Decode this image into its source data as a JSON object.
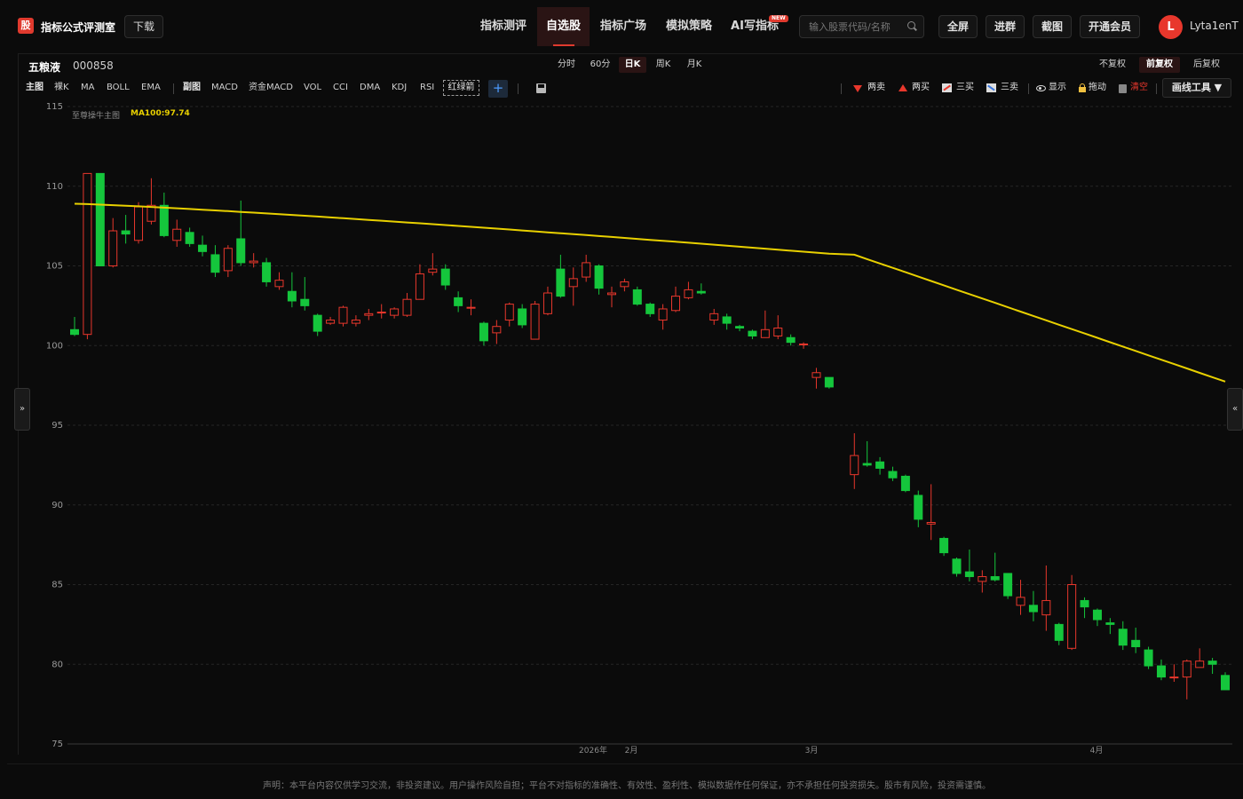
{
  "header": {
    "logo_text": "股",
    "brand": "指标公式评测室",
    "download": "下载",
    "nav": [
      {
        "label": "指标测评",
        "active": false
      },
      {
        "label": "自选股",
        "active": true
      },
      {
        "label": "指标广场",
        "active": false
      },
      {
        "label": "模拟策略",
        "active": false
      },
      {
        "label": "AI写指标",
        "active": false
      }
    ],
    "new_badge": "NEW",
    "search_placeholder": "输入股票代码/名称",
    "buttons": [
      "全屏",
      "进群",
      "截图",
      "开通会员"
    ],
    "avatar_letter": "L",
    "username": "Lyta1enT"
  },
  "stock": {
    "name": "五粮液",
    "code": "000858"
  },
  "periods": [
    {
      "label": "分时",
      "active": false
    },
    {
      "label": "60分",
      "active": false
    },
    {
      "label": "日K",
      "active": true
    },
    {
      "label": "周K",
      "active": false
    },
    {
      "label": "月K",
      "active": false
    }
  ],
  "adjustments": [
    {
      "label": "不复权",
      "active": false
    },
    {
      "label": "前复权",
      "active": true
    },
    {
      "label": "后复权",
      "active": false
    }
  ],
  "indicator_bar": {
    "main_label": "主图",
    "main_items": [
      "裸K",
      "MA",
      "BOLL",
      "EMA"
    ],
    "sub_label": "副图",
    "sub_items": [
      "MACD",
      "资金MACD",
      "VOL",
      "CCI",
      "DMA",
      "KDJ",
      "RSI"
    ],
    "red_green_arrow": "红绿箭",
    "add": "+"
  },
  "draw_bar": {
    "two_sell": "两卖",
    "two_buy": "两买",
    "three_buy": "三买",
    "three_sell": "三卖",
    "show": "显示",
    "drag": "拖动",
    "clear": "清空",
    "draw_tools": "画线工具 ▼"
  },
  "legend": {
    "main": "至尊操牛主图",
    "ma": "MA100:97.74"
  },
  "side": {
    "left": "»",
    "right": "«"
  },
  "colors": {
    "up": "#e8372c",
    "down": "#15c63c",
    "ma": "#e8d000",
    "accent": "#e03a2e"
  },
  "chart_data": {
    "type": "candlestick",
    "y_ticks": [
      115,
      110,
      105,
      100,
      95,
      90,
      85,
      80,
      75
    ],
    "ylim": [
      75,
      115
    ],
    "x_labels": [
      "2026年",
      "2月",
      "3月",
      "4月"
    ],
    "ma100_start": 108.9,
    "ma100_last": 97.74,
    "candles": [
      [
        101.0,
        100.7,
        101.8,
        100.6
      ],
      [
        100.7,
        110.8,
        110.8,
        100.4
      ],
      [
        110.8,
        105.0,
        110.8,
        105.0
      ],
      [
        105.0,
        107.2,
        108.0,
        104.9
      ],
      [
        107.2,
        107.0,
        108.2,
        106.4
      ],
      [
        106.6,
        108.7,
        109.0,
        106.4
      ],
      [
        107.8,
        108.8,
        110.5,
        107.6
      ],
      [
        108.8,
        106.9,
        109.6,
        106.8
      ],
      [
        106.6,
        107.3,
        107.9,
        106.2
      ],
      [
        107.1,
        106.4,
        107.4,
        106.2
      ],
      [
        106.3,
        105.9,
        106.9,
        105.6
      ],
      [
        105.7,
        104.6,
        106.3,
        104.3
      ],
      [
        104.7,
        106.1,
        106.3,
        104.3
      ],
      [
        106.7,
        105.2,
        109.1,
        105.0
      ],
      [
        105.2,
        105.3,
        105.8,
        104.9
      ],
      [
        105.2,
        104.0,
        105.5,
        103.7
      ],
      [
        103.7,
        104.1,
        104.6,
        103.5
      ],
      [
        103.4,
        102.8,
        104.6,
        102.4
      ],
      [
        102.9,
        102.5,
        104.3,
        102.2
      ],
      [
        101.9,
        100.9,
        102.0,
        100.6
      ],
      [
        101.4,
        101.6,
        101.8,
        101.3
      ],
      [
        101.4,
        102.4,
        102.5,
        101.2
      ],
      [
        101.4,
        101.6,
        101.9,
        101.2
      ],
      [
        101.9,
        102.0,
        102.3,
        101.6
      ],
      [
        102.1,
        102.1,
        102.6,
        101.7
      ],
      [
        101.9,
        102.3,
        102.4,
        101.7
      ],
      [
        101.9,
        102.9,
        103.3,
        101.8
      ],
      [
        102.9,
        104.5,
        105.1,
        102.9
      ],
      [
        104.6,
        104.8,
        105.8,
        104.4
      ],
      [
        104.8,
        103.8,
        105.1,
        103.5
      ],
      [
        103.0,
        102.5,
        103.4,
        102.1
      ],
      [
        102.4,
        102.4,
        102.9,
        101.9
      ],
      [
        101.4,
        100.3,
        101.5,
        100.0
      ],
      [
        100.8,
        101.2,
        101.6,
        100.1
      ],
      [
        101.6,
        102.6,
        102.7,
        101.2
      ],
      [
        102.3,
        101.3,
        102.6,
        101.1
      ],
      [
        100.4,
        102.6,
        102.8,
        100.4
      ],
      [
        102.0,
        103.3,
        103.7,
        101.9
      ],
      [
        104.8,
        103.1,
        105.7,
        103.0
      ],
      [
        103.7,
        104.2,
        104.9,
        102.5
      ],
      [
        104.3,
        105.2,
        105.7,
        104.0
      ],
      [
        105.0,
        103.6,
        105.1,
        103.2
      ],
      [
        103.2,
        103.3,
        103.7,
        102.4
      ],
      [
        103.7,
        104.0,
        104.2,
        103.4
      ],
      [
        103.5,
        102.6,
        103.7,
        102.5
      ],
      [
        102.6,
        102.0,
        102.7,
        101.8
      ],
      [
        101.6,
        102.3,
        102.6,
        101.0
      ],
      [
        102.2,
        103.1,
        103.7,
        102.1
      ],
      [
        103.0,
        103.5,
        104.0,
        102.9
      ],
      [
        103.4,
        103.3,
        103.9,
        103.2
      ],
      [
        101.6,
        102.0,
        102.3,
        101.3
      ],
      [
        101.8,
        101.4,
        102.0,
        101.0
      ],
      [
        101.2,
        101.1,
        101.3,
        100.9
      ],
      [
        100.9,
        100.6,
        101.0,
        100.4
      ],
      [
        100.5,
        101.0,
        102.2,
        100.5
      ],
      [
        100.6,
        101.1,
        101.9,
        100.4
      ],
      [
        100.5,
        100.2,
        100.7,
        100.0
      ],
      [
        100.1,
        100.1,
        100.2,
        99.8
      ],
      [
        98.0,
        98.3,
        98.6,
        97.3
      ],
      [
        98.0,
        97.4,
        98.0,
        97.3
      ],
      [
        91.9,
        93.1,
        94.5,
        91.0
      ],
      [
        92.6,
        92.5,
        94.0,
        92.4
      ],
      [
        92.7,
        92.3,
        93.0,
        91.9
      ],
      [
        92.1,
        91.7,
        92.4,
        91.5
      ],
      [
        91.8,
        90.9,
        91.9,
        90.8
      ],
      [
        90.6,
        89.1,
        90.9,
        88.6
      ],
      [
        88.8,
        88.9,
        91.3,
        87.8
      ],
      [
        87.9,
        87.0,
        88.0,
        86.8
      ],
      [
        86.6,
        85.7,
        86.7,
        85.5
      ],
      [
        85.8,
        85.5,
        87.2,
        85.2
      ],
      [
        85.2,
        85.5,
        85.9,
        84.5
      ],
      [
        85.5,
        85.3,
        87.0,
        85.2
      ],
      [
        85.7,
        84.3,
        85.7,
        84.1
      ],
      [
        83.7,
        84.2,
        85.3,
        83.1
      ],
      [
        83.7,
        83.3,
        84.6,
        82.7
      ],
      [
        83.1,
        84.0,
        86.2,
        82.1
      ],
      [
        82.5,
        81.5,
        82.6,
        81.2
      ],
      [
        81.0,
        85.0,
        85.6,
        80.9
      ],
      [
        84.0,
        83.6,
        84.2,
        82.9
      ],
      [
        83.4,
        82.8,
        83.5,
        82.4
      ],
      [
        82.6,
        82.5,
        82.9,
        81.9
      ],
      [
        82.2,
        81.2,
        82.7,
        80.9
      ],
      [
        81.5,
        81.1,
        82.3,
        80.7
      ],
      [
        80.9,
        79.9,
        81.1,
        79.7
      ],
      [
        79.9,
        79.2,
        80.3,
        79.0
      ],
      [
        79.2,
        79.2,
        80.0,
        78.9
      ],
      [
        79.2,
        80.2,
        80.3,
        77.8
      ],
      [
        79.8,
        80.2,
        81.0,
        79.9
      ],
      [
        80.2,
        80.0,
        80.4,
        79.4
      ],
      [
        79.3,
        78.4,
        79.5,
        78.4
      ]
    ]
  }
}
